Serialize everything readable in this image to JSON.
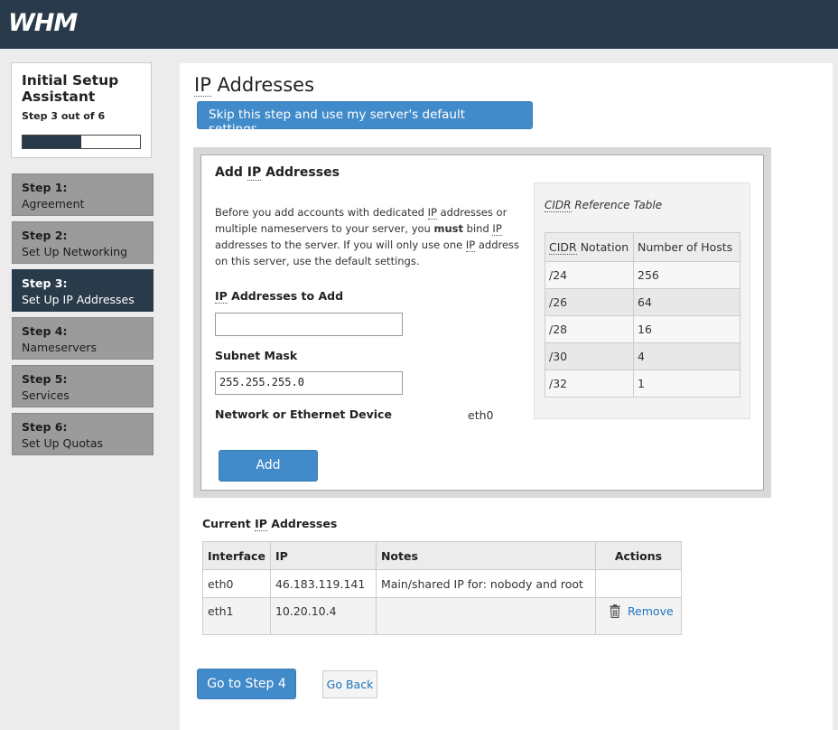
{
  "header": {
    "logo": "WHM"
  },
  "assistant": {
    "title": "Initial Setup Assistant",
    "step_text": "Step 3 out of 6",
    "progress_fraction": 0.5
  },
  "steps": [
    {
      "num": "Step 1:",
      "label": "Agreement"
    },
    {
      "num": "Step 2:",
      "label": "Set Up Networking"
    },
    {
      "num": "Step 3:",
      "label": "Set Up IP Addresses"
    },
    {
      "num": "Step 4:",
      "label": "Nameservers"
    },
    {
      "num": "Step 5:",
      "label": "Services"
    },
    {
      "num": "Step 6:",
      "label": "Set Up Quotas"
    }
  ],
  "page": {
    "title_abbr": "IP",
    "title_rest": " Addresses",
    "skip_button": "Skip this step and use my server's default settings."
  },
  "add_form": {
    "heading_pre": "Add ",
    "heading_abbr": "IP",
    "heading_post": " Addresses",
    "desc_1": "Before you add accounts with dedicated ",
    "desc_ip1": "IP",
    "desc_2": " addresses or multiple nameservers to your server, you ",
    "desc_must": "must",
    "desc_3": " bind ",
    "desc_ip2": "IP",
    "desc_4": " addresses to the server. If you will only use one ",
    "desc_ip3": "IP",
    "desc_5": " address on this server, use the default settings.",
    "ip_label_abbr": "IP",
    "ip_label_rest": " Addresses to Add",
    "ip_value": "",
    "subnet_label": "Subnet Mask",
    "subnet_value": "255.255.255.0",
    "device_label": "Network or Ethernet Device",
    "device_value": "eth0",
    "add_button": "Add"
  },
  "cidr": {
    "caption_abbr": "CIDR",
    "caption_rest": " Reference Table",
    "col1_abbr": "CIDR",
    "col1_rest": " Notation",
    "col2": "Number of Hosts",
    "rows": [
      {
        "notation": "/24",
        "hosts": "256"
      },
      {
        "notation": "/26",
        "hosts": "64"
      },
      {
        "notation": "/28",
        "hosts": "16"
      },
      {
        "notation": "/30",
        "hosts": "4"
      },
      {
        "notation": "/32",
        "hosts": "1"
      }
    ]
  },
  "current": {
    "heading_pre": "Current ",
    "heading_abbr": "IP",
    "heading_post": " Addresses",
    "columns": [
      "Interface",
      "IP",
      "Notes",
      "Actions"
    ],
    "rows": [
      {
        "interface": "eth0",
        "ip": "46.183.119.141",
        "notes": "Main/shared IP for: nobody and root",
        "action": ""
      },
      {
        "interface": "eth1",
        "ip": "10.20.10.4",
        "notes": "",
        "action": "Remove"
      }
    ]
  },
  "footer": {
    "next_button": "Go to Step 4",
    "back_button": "Go Back"
  }
}
